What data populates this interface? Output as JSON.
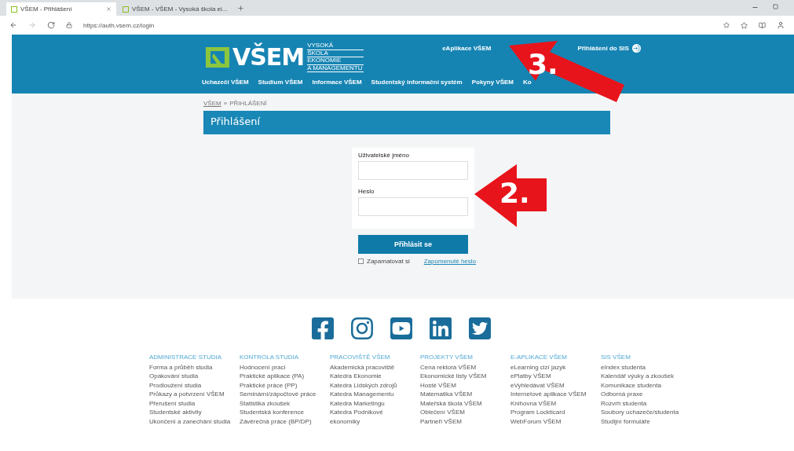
{
  "browser": {
    "tabs": [
      {
        "title": "VŠEM - Přihlášení",
        "selected": true
      },
      {
        "title": "VŠEM - VŠEM - Vysoká škola ei...",
        "selected": false
      }
    ],
    "url": "https://auth.vsem.cz/login"
  },
  "header": {
    "logo_text": "VŠEM",
    "logo_subtitle": [
      "VYSOKÁ",
      "ŠKOLA",
      "EKONOMIE",
      "A MANAGEMENTU"
    ],
    "top_links": [
      {
        "label": "eAplikace VŠEM",
        "kind": "text"
      },
      {
        "label": "Přihlášení do SIS",
        "kind": "login"
      }
    ],
    "nav": [
      "Uchazeči VŠEM",
      "Studium VŠEM",
      "Informace VŠEM",
      "Studentský informační systém",
      "Pokyny VŠEM",
      "Ko"
    ]
  },
  "breadcrumb": [
    {
      "label": "VŠEM",
      "kind": "link"
    },
    {
      "label": "»",
      "kind": "sep"
    },
    {
      "label": "PŘIHLÁŠENÍ",
      "kind": "text"
    }
  ],
  "page_title": "Přihlášení",
  "login": {
    "username_label": "Uživatelské jméno",
    "password_label": "Heslo",
    "submit": "Přihlásit se",
    "remember": {
      "label": "Zapamatovat si",
      "checked": false
    },
    "forgot": "Zapomenuté heslo"
  },
  "footer_columns": [
    {
      "heading": "ADMINISTRACE STUDIA",
      "links": [
        "Forma a průběh studia",
        "Opakování studia",
        "Prodloužení studia",
        "Průkazy a potvrzení VŠEM",
        "Přerušení studia",
        "Studentské aktivity",
        "Ukončení a zanechání studia"
      ]
    },
    {
      "heading": "KONTROLA STUDIA",
      "links": [
        "Hodnocení prací",
        "Praktické aplikace (PA)",
        "Praktické práce (PP)",
        "Seminární/zápočtové práce",
        "Statistika zkoušek",
        "Studentská konference",
        "Závěrečná práce (BP/DP)"
      ]
    },
    {
      "heading": "PRACOVIŠTĚ VŠEM",
      "links": [
        "Akademická pracoviště",
        "Katedra Ekonomie",
        "Katedra Lidských zdrojů",
        "Katedra Managementu",
        "Katedra Marketingu",
        "Katedra Podnikové",
        "ekonomiky"
      ]
    },
    {
      "heading": "PROJEKTY VŠEM",
      "links": [
        "Cena rektora VŠEM",
        "Ekonomické listy VŠEM",
        "Hosté VŠEM",
        "Matematika VŠEM",
        "Mateřská škola VŠEM",
        "Oblečení VŠEM",
        "Partneři VŠEM"
      ]
    },
    {
      "heading": "E-APLIKACE VŠEM",
      "links": [
        "eLearning cizí jazyk",
        "ePlatby VŠEM",
        "eVyhledávat VŠEM",
        "Internetové aplikace VŠEM",
        "Knihovna VŠEM",
        "Program Lockticard",
        "WebForum VŠEM"
      ]
    },
    {
      "heading": "SIS VŠEM",
      "links": [
        "eIndex studenta",
        "Kalendář výuky a zkoušek",
        "Komunikace studenta",
        "Odborná praxe",
        "Rozvrh studenta",
        "Soubory uchazeče/studenta",
        "Studijní formuláře"
      ]
    }
  ],
  "annotations": [
    {
      "label": "3.",
      "kind": "diagonal"
    },
    {
      "label": "2.",
      "kind": "left"
    }
  ]
}
